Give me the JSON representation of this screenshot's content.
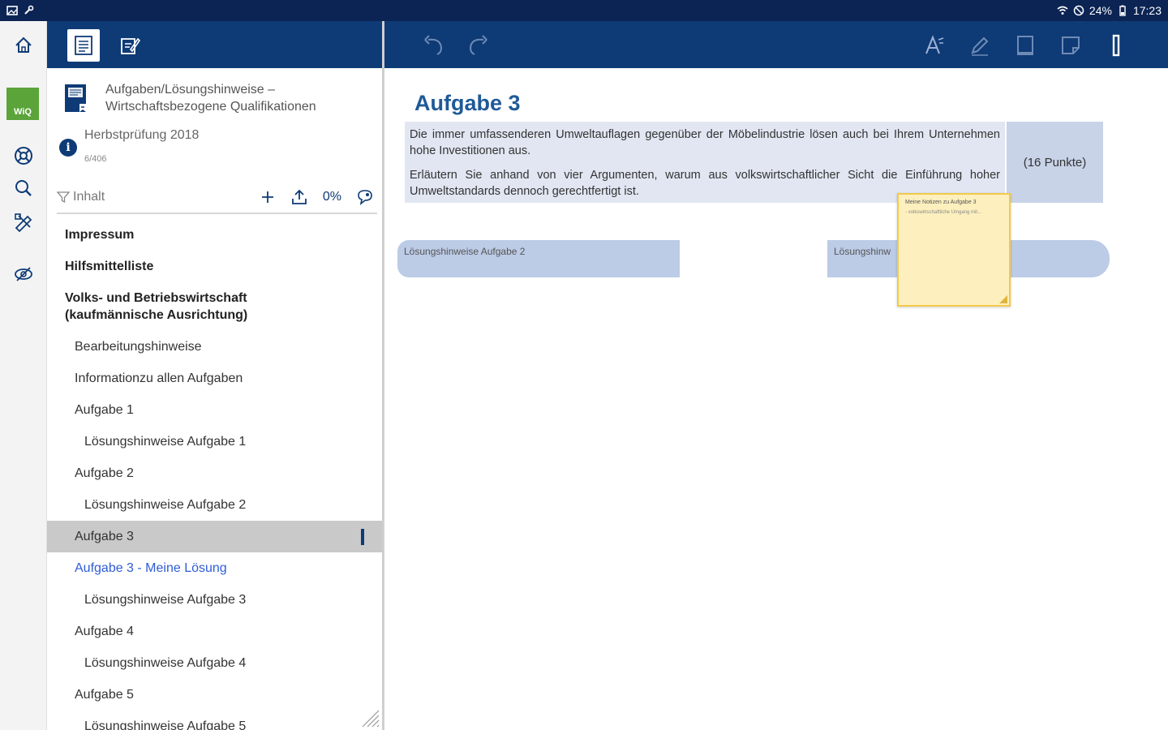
{
  "status_bar": {
    "battery": "24%",
    "time": "17:23"
  },
  "book": {
    "title": "Aufgaben/Lösungshinweise – Wirtschaftsbezogene Qualifikationen",
    "subtitle": "Herbstprüfung 2018",
    "page_count": "6/406",
    "brand_badge": "WiQ"
  },
  "filter": {
    "label": "Inhalt",
    "progress": "0%"
  },
  "toc": [
    {
      "label": "Impressum",
      "level": 0,
      "bold": true
    },
    {
      "label": "Hilfsmittelliste",
      "level": 0,
      "bold": true
    },
    {
      "label": "Volks- und Betriebswirtschaft (kaufmännische Ausrichtung)",
      "level": 0,
      "bold": true
    },
    {
      "label": "Bearbeitungshinweise",
      "level": 1
    },
    {
      "label": "Informationzu allen Aufgaben",
      "level": 1
    },
    {
      "label": "Aufgabe 1",
      "level": 1
    },
    {
      "label": "Lösungshinweise Aufgabe 1",
      "level": 2
    },
    {
      "label": "Aufgabe 2",
      "level": 1
    },
    {
      "label": "Lösungshinweise Aufgabe 2",
      "level": 2
    },
    {
      "label": "Aufgabe 3",
      "level": 1,
      "active": true
    },
    {
      "label": "Aufgabe 3 - Meine Lösung",
      "level": 1,
      "link": true
    },
    {
      "label": "Lösungshinweise Aufgabe 3",
      "level": 2
    },
    {
      "label": "Aufgabe 4",
      "level": 1
    },
    {
      "label": "Lösungshinweise Aufgabe 4",
      "level": 2
    },
    {
      "label": "Aufgabe 5",
      "level": 1
    },
    {
      "label": "Lösungshinweise Aufgabe 5",
      "level": 2
    }
  ],
  "main": {
    "heading": "Aufgabe 3",
    "task_paragraph_1": "Die immer umfassenderen Umweltauflagen gegenüber der Möbelindustrie lösen auch bei Ihrem Unternehmen hohe Investitionen aus.",
    "task_paragraph_2": "Erläutern Sie anhand von vier Argumenten, warum aus volkswirtschaftlicher Sicht die Einführung hoher Umweltstandards dennoch gerechtfertigt ist.",
    "points": "(16 Punkte)",
    "solution_left": "Lösungshinweise Aufgabe 2",
    "solution_right": "Lösungshinw",
    "note_title": "Meine Notizen zu Aufgabe 3",
    "note_body": "- volkswirtschaftliche Umgang mit..."
  },
  "colors": {
    "header_navy": "#0e3b76",
    "status_navy": "#0b2454",
    "heading_blue": "#1f5a98",
    "link_blue": "#2e5cd6",
    "brand_green": "#5aa43a",
    "note_yellow": "#fdf0be"
  }
}
